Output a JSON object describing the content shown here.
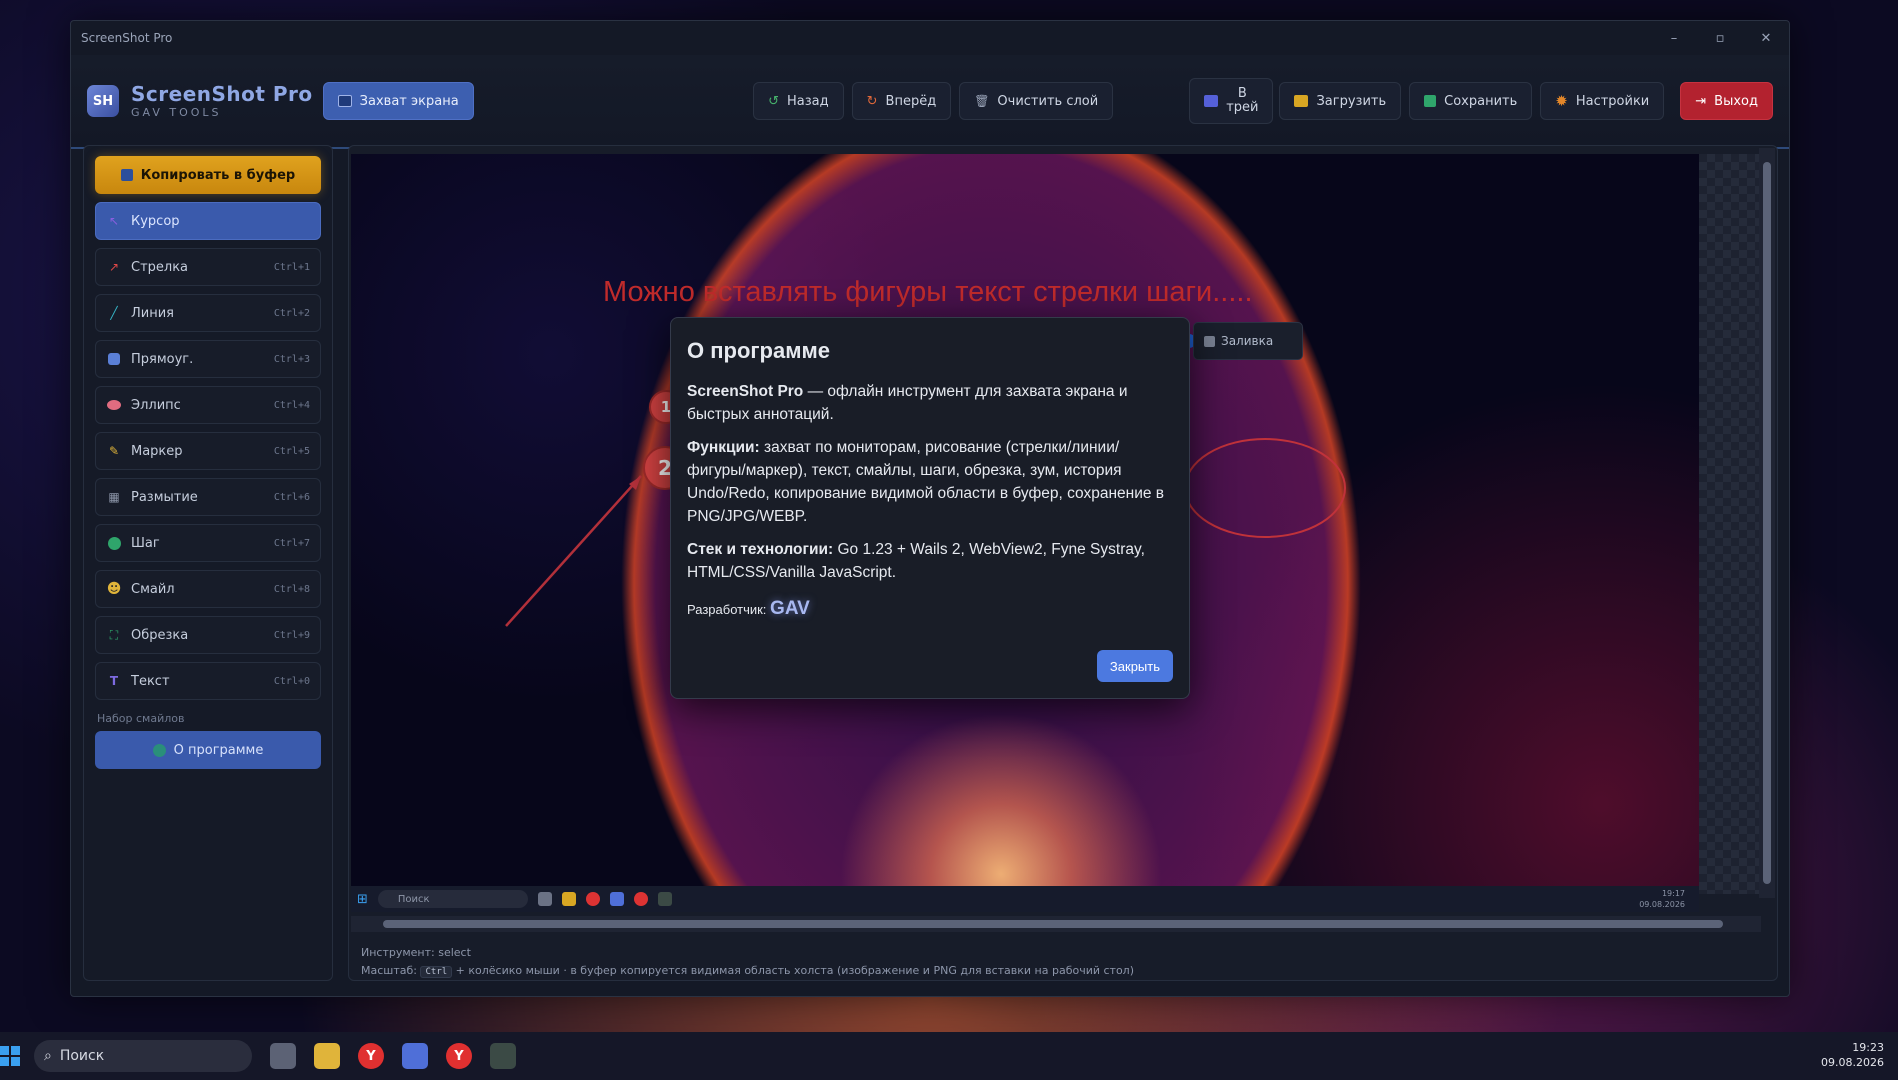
{
  "window": {
    "title": "ScreenShot Pro",
    "controls": {
      "minimize": "–",
      "maximize": "▫",
      "close": "✕"
    }
  },
  "toolbar": {
    "logo_text": "SH",
    "brand_name": "ScreenShot Pro",
    "brand_sub": "GAV TOOLS",
    "capture_label": "Захват экрана",
    "back_label": "Назад",
    "forward_label": "Вперёд",
    "clear_layer_label": "Очистить слой",
    "tray_label_line1": "В",
    "tray_label_line2": "трей",
    "load_label": "Загрузить",
    "save_label": "Сохранить",
    "settings_label": "Настройки",
    "exit_label": "Выход"
  },
  "sidebar": {
    "copy_label": "Копировать в буфер",
    "tools": [
      {
        "label": "Курсор",
        "shortcut": ""
      },
      {
        "label": "Стрелка",
        "shortcut": "Ctrl+1"
      },
      {
        "label": "Линия",
        "shortcut": "Ctrl+2"
      },
      {
        "label": "Прямоуг.",
        "shortcut": "Ctrl+3"
      },
      {
        "label": "Эллипс",
        "shortcut": "Ctrl+4"
      },
      {
        "label": "Маркер",
        "shortcut": "Ctrl+5"
      },
      {
        "label": "Размытие",
        "shortcut": "Ctrl+6"
      },
      {
        "label": "Шаг",
        "shortcut": "Ctrl+7"
      },
      {
        "label": "Смайл",
        "shortcut": "Ctrl+8"
      },
      {
        "label": "Обрезка",
        "shortcut": "Ctrl+9"
      },
      {
        "label": "Текст",
        "shortcut": "Ctrl+0"
      }
    ],
    "smiles_section": "Набор смайлов",
    "about_label": "О программе"
  },
  "canvas": {
    "annotation_text": "Можно вставлять фигуры текст стрелки шаги.....",
    "step1": "1",
    "step2": "2",
    "fill_label": "Заливка",
    "inner_search": "Поиск",
    "inner_time": "19:17",
    "inner_date": "09.08.2026"
  },
  "status": {
    "tool_line": "Инструмент: select",
    "zoom_prefix": "Масштаб:",
    "zoom_key": "Ctrl",
    "zoom_suffix": "+ колёсико мыши · в буфер копируется видимая область холста (изображение и PNG для вставки на рабочий стол)"
  },
  "modal": {
    "title": "О программе",
    "p1_bold": "ScreenShot Pro",
    "p1_text": " — офлайн инструмент для захвата экрана и быстрых аннотаций.",
    "p2_bold": "Функции:",
    "p2_text": " захват по мониторам, рисование (стрелки/линии/фигуры/маркер), текст, смайлы, шаги, обрезка, зум, история Undo/Redo, копирование видимой области в буфер, сохранение в PNG/JPG/WEBP.",
    "p3_bold": "Стек и технологии:",
    "p3_text": " Go 1.23 + Wails 2, WebView2, Fyne Systray, HTML/CSS/Vanilla JavaScript.",
    "dev_label": "Разработчик:",
    "dev_name": "GAV",
    "close_label": "Закрыть"
  },
  "os_taskbar": {
    "search_placeholder": "Поиск",
    "time": "19:23",
    "date": "09.08.2026"
  },
  "colors": {
    "accent": "#3d5fb0",
    "danger": "#b3222f",
    "copy_gold": "#e0a21e",
    "annotation_red": "#c02b2b"
  }
}
